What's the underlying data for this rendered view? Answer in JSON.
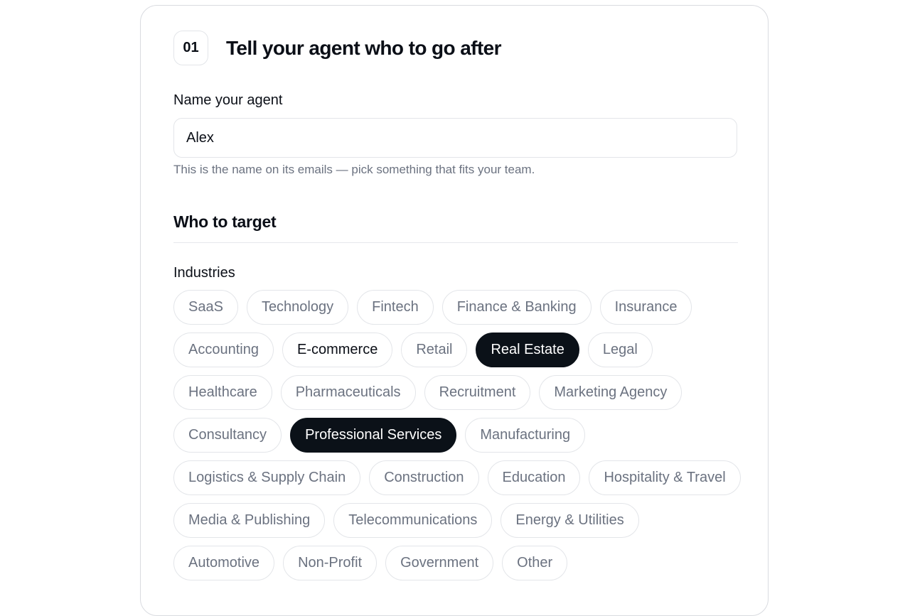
{
  "step": {
    "number": "01",
    "title": "Tell your agent who to go after"
  },
  "agent_name": {
    "label": "Name your agent",
    "value": "Alex",
    "helper": "This is the name on its emails — pick something that fits your team."
  },
  "target": {
    "section_title": "Who to target",
    "industries_label": "Industries",
    "industries": [
      {
        "label": "SaaS",
        "selected": false
      },
      {
        "label": "Technology",
        "selected": false
      },
      {
        "label": "Fintech",
        "selected": false
      },
      {
        "label": "Finance & Banking",
        "selected": false
      },
      {
        "label": "Insurance",
        "selected": false
      },
      {
        "label": "Accounting",
        "selected": false
      },
      {
        "label": "E-commerce",
        "selected": false,
        "emphasis": true
      },
      {
        "label": "Retail",
        "selected": false
      },
      {
        "label": "Real Estate",
        "selected": true
      },
      {
        "label": "Legal",
        "selected": false
      },
      {
        "label": "Healthcare",
        "selected": false
      },
      {
        "label": "Pharmaceuticals",
        "selected": false
      },
      {
        "label": "Recruitment",
        "selected": false
      },
      {
        "label": "Marketing Agency",
        "selected": false
      },
      {
        "label": "Consultancy",
        "selected": false
      },
      {
        "label": "Professional Services",
        "selected": true
      },
      {
        "label": "Manufacturing",
        "selected": false
      },
      {
        "label": "Logistics & Supply Chain",
        "selected": false
      },
      {
        "label": "Construction",
        "selected": false
      },
      {
        "label": "Education",
        "selected": false
      },
      {
        "label": "Hospitality & Travel",
        "selected": false
      },
      {
        "label": "Media & Publishing",
        "selected": false
      },
      {
        "label": "Telecommunications",
        "selected": false
      },
      {
        "label": "Energy & Utilities",
        "selected": false
      },
      {
        "label": "Automotive",
        "selected": false
      },
      {
        "label": "Non-Profit",
        "selected": false
      },
      {
        "label": "Government",
        "selected": false
      },
      {
        "label": "Other",
        "selected": false
      }
    ]
  },
  "colors": {
    "selected_chip_bg": "#0b1118",
    "chip_text": "#6b7280",
    "border": "#e3e5e9"
  }
}
